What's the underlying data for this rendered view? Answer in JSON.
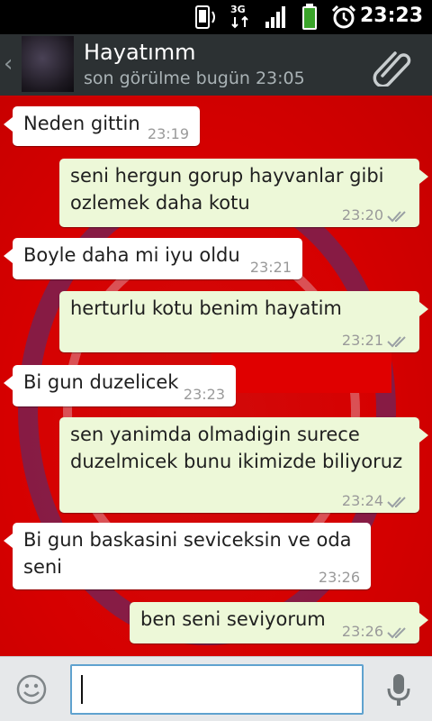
{
  "status_bar": {
    "time": "23:23",
    "network": "3G",
    "icons": [
      "phone-screen-icon",
      "network-3g-icon",
      "signal-icon",
      "battery-icon",
      "alarm-icon"
    ]
  },
  "header": {
    "back_icon": "chevron-left-icon",
    "contact_name": "Hayatımm",
    "last_seen": "son görülme bugün 23:05",
    "attach_icon": "paperclip-icon"
  },
  "messages": [
    {
      "direction": "in",
      "text": "Neden gittin",
      "time": "23:19"
    },
    {
      "direction": "out",
      "text": "seni hergun gorup hayvanlar gibi ozlemek daha kotu",
      "time": "23:20",
      "status": "read"
    },
    {
      "direction": "in",
      "text": "Boyle daha mi iyu oldu",
      "time": "23:21"
    },
    {
      "direction": "out",
      "text": "herturlu kotu benim hayatim",
      "time": "23:21",
      "status": "read"
    },
    {
      "direction": "in",
      "text": "Bi gun duzelicek",
      "time": "23:23"
    },
    {
      "direction": "out",
      "text": "sen yanimda olmadigin surece duzelmicek bunu ikimizde biliyoruz",
      "time": "23:24",
      "status": "read"
    },
    {
      "direction": "in",
      "text": "Bi gun baskasini seviceksin ve oda seni",
      "time": "23:26"
    },
    {
      "direction": "out",
      "text": "ben seni seviyorum",
      "time": "23:26",
      "status": "read"
    }
  ],
  "input": {
    "value": "",
    "emoji_icon": "smiley-icon",
    "mic_icon": "microphone-icon"
  },
  "colors": {
    "wallpaper": "#d60000",
    "header_bg": "#2c3133",
    "incoming_bubble": "#ffffff",
    "outgoing_bubble": "#edf8d8",
    "read_ticks": "#9aa0a4",
    "input_border": "#5fa2cf"
  }
}
